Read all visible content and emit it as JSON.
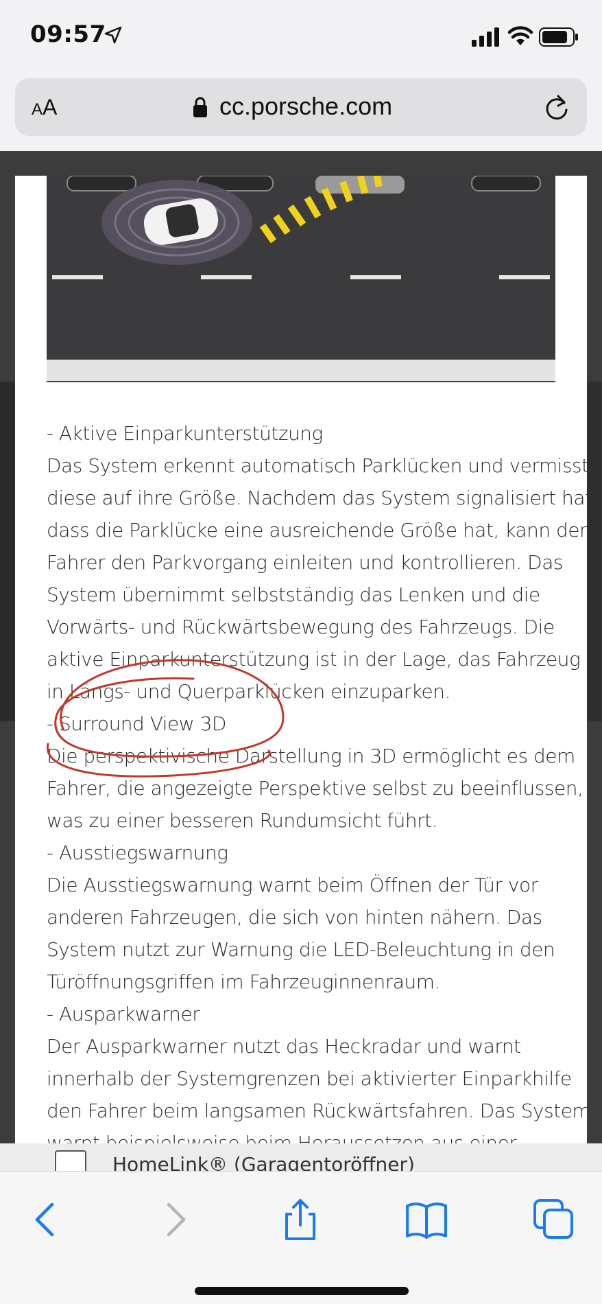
{
  "status_bar": {
    "time": "09:57",
    "icons": [
      "location-arrow-icon",
      "cellular-signal-icon",
      "wifi-icon",
      "battery-icon"
    ]
  },
  "url_bar": {
    "text_size_small": "A",
    "text_size_big": "A",
    "domain": "cc.porsche.com",
    "icons": [
      "lock-icon",
      "reload-icon"
    ]
  },
  "modal": {
    "paragraphs": [
      "- Aktive Einparkunterstützung",
      "Das System erkennt automatisch Parklücken und vermisst",
      "diese auf ihre Größe. Nachdem das System signalisiert hat,",
      "dass die Parklücke eine ausreichende Größe hat, kann der",
      "Fahrer den Parkvorgang einleiten und kontrollieren. Das",
      "System übernimmt selbstständig das Lenken und die",
      "Vorwärts- und Rückwärtsbewegung des Fahrzeugs. Die",
      "aktive Einparkunterstützung ist in der Lage, das Fahrzeug",
      "in Längs- und Querparklücken einzuparken.",
      "- Surround View 3D",
      "Die perspektivische Darstellung in 3D ermöglicht es dem",
      "Fahrer, die angezeigte Perspektive selbst zu beeinflussen,",
      "was zu einer besseren Rundumsicht führt.",
      "- Ausstiegswarnung",
      "Die Ausstiegswarnung warnt beim Öffnen der Tür vor",
      "anderen Fahrzeugen, die sich von hinten nähern. Das",
      "System nutzt zur Warnung die LED-Beleuchtung in den",
      "Türöffnungsgriffen im Fahrzeuginnenraum.",
      "- Ausparkwarner",
      "Der Ausparkwarner nutzt das Heckradar und warnt",
      "innerhalb der Systemgrenzen bei aktivierter Einparkhilfe",
      "den Fahrer beim langsamen Rückwärtsfahren. Das System",
      "warnt beispielsweise beim Heraussetzen aus einer"
    ],
    "highlight_color": "#c0392b"
  },
  "underlying_row": {
    "label": "HomeLink® (Garagentoröffner)"
  },
  "toolbar": {
    "buttons": [
      "back-icon",
      "forward-icon",
      "share-icon",
      "bookmarks-icon",
      "tabs-icon"
    ],
    "accent": "#1a7cf0",
    "disabled": "#b5b5b9"
  }
}
